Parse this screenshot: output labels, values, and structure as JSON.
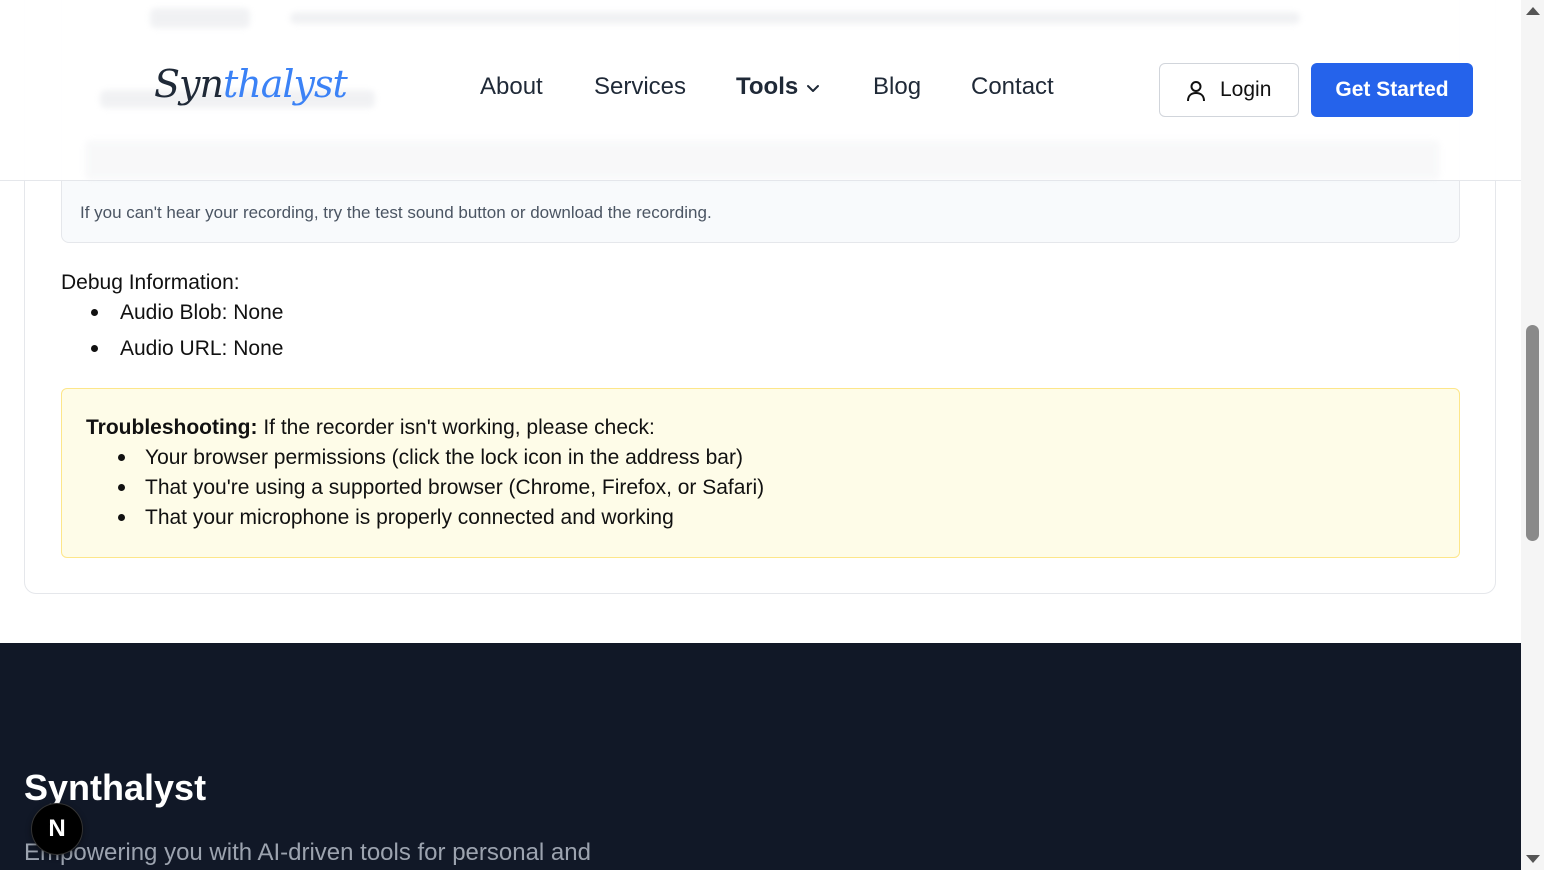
{
  "header": {
    "logo_prefix": "Syn",
    "logo_suffix": "thalyst",
    "nav": [
      "About",
      "Services",
      "Tools",
      "Blog",
      "Contact"
    ],
    "login_label": "Login",
    "cta_label": "Get Started"
  },
  "recorder": {
    "help_text": "If you can't hear your recording, try the test sound button or download the recording."
  },
  "debug": {
    "title": "Debug Information:",
    "items": [
      "Audio Blob: None",
      "Audio URL: None"
    ]
  },
  "troubleshooting": {
    "label": "Troubleshooting:",
    "intro": " If the recorder isn't working, please check:",
    "items": [
      "Your browser permissions (click the lock icon in the address bar)",
      "That you're using a supported browser (Chrome, Firefox, or Safari)",
      "That your microphone is properly connected and working"
    ]
  },
  "footer": {
    "brand": "Synthalyst",
    "tagline": "Empowering you with AI-driven tools for personal and"
  },
  "badge": {
    "letter": "N"
  },
  "colors": {
    "primary": "#2563eb",
    "footer_bg": "#111827",
    "warning_bg": "#fefce8"
  }
}
